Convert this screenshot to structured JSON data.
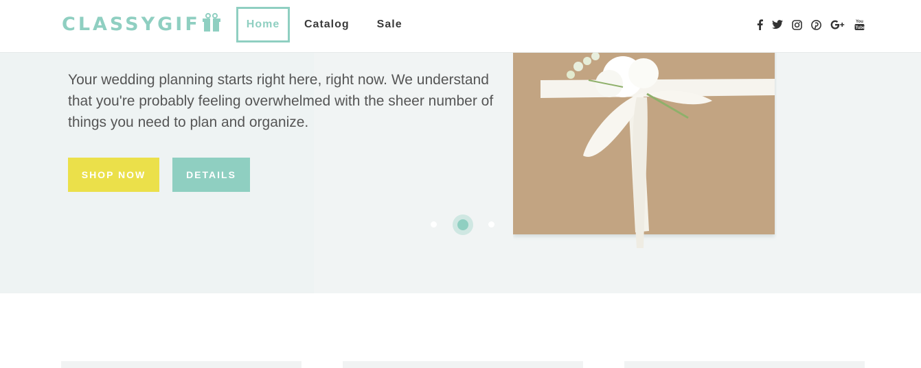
{
  "brand": {
    "logo_text": "CLASSYGIFT",
    "logo_main": "CLASSYGIF",
    "accent": "#8fcfc1",
    "yellow": "#ebe04a"
  },
  "nav": {
    "items": [
      {
        "label": "Home"
      },
      {
        "label": "Catalog"
      },
      {
        "label": "Sale"
      }
    ],
    "active": "Home"
  },
  "social": [
    "facebook-icon",
    "twitter-icon",
    "instagram-icon",
    "pinterest-icon",
    "google-plus-icon",
    "youtube-icon"
  ],
  "hero": {
    "text": "Your wedding planning starts right here, right now. We understand that you're probably feeling overwhelmed with the sheer number of things you need to plan and organize.",
    "shop_label": "SHOP NOW",
    "details_label": "DETAILS",
    "slides": 3,
    "active_slide": 2
  }
}
